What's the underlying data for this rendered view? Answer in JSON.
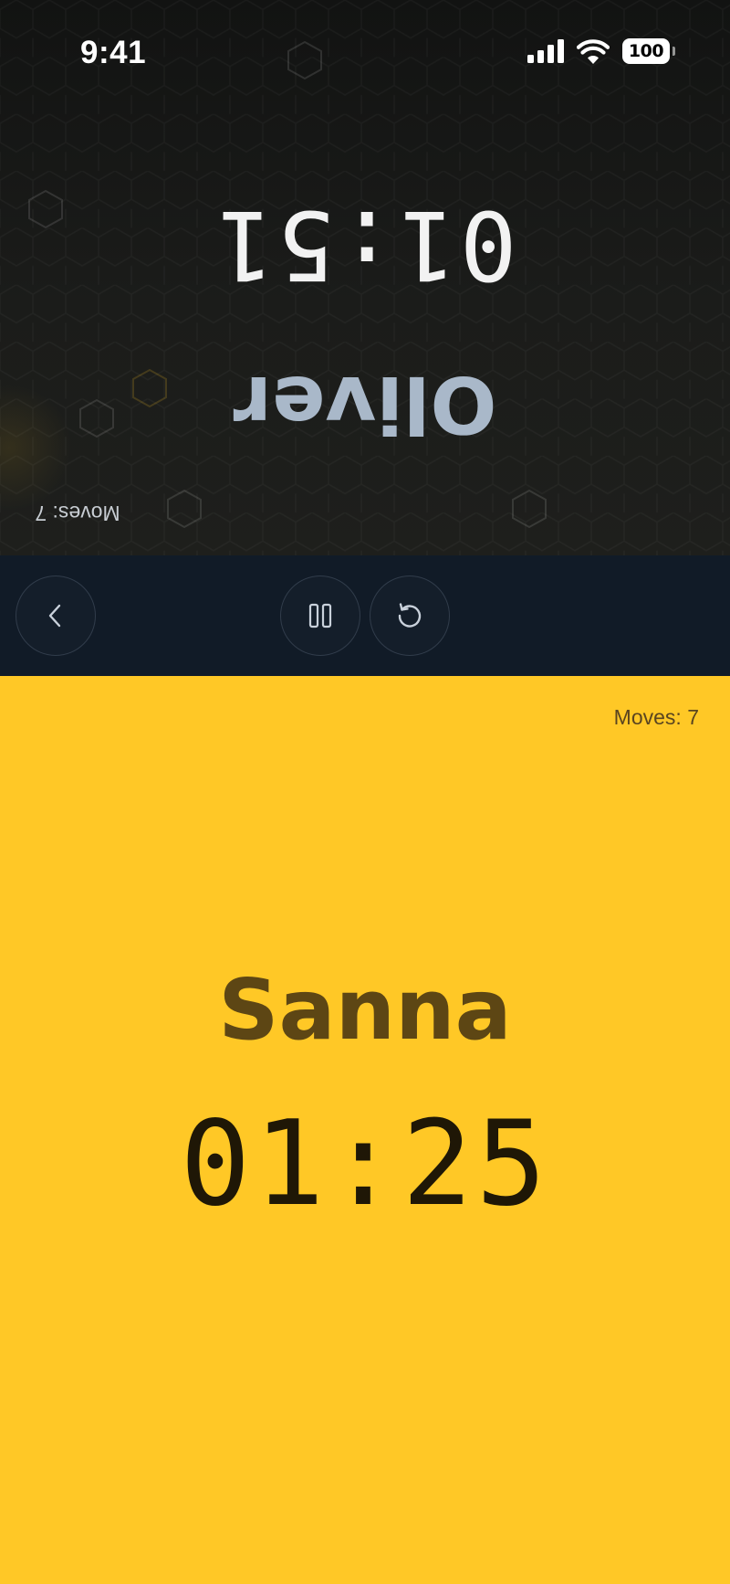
{
  "status_bar": {
    "time": "9:41",
    "battery": "100"
  },
  "opponent": {
    "name": "Oliver",
    "time": "01:51",
    "moves": "Moves: 7"
  },
  "controls": {
    "back": "back",
    "pause": "pause",
    "reset": "reset"
  },
  "player": {
    "name": "Sanna",
    "time": "01:25",
    "moves": "Moves: 7"
  },
  "colors": {
    "active_background": "#FFC826",
    "opponent_background": "#1b1c1a",
    "controls_background": "#111b27",
    "opponent_name": "#A9B8C9",
    "player_name": "#5d4614",
    "player_timer": "#1f1706"
  },
  "icons": [
    "signal-icon",
    "wifi-icon",
    "battery-icon",
    "chevron-left-icon",
    "pause-icon",
    "reset-icon"
  ]
}
